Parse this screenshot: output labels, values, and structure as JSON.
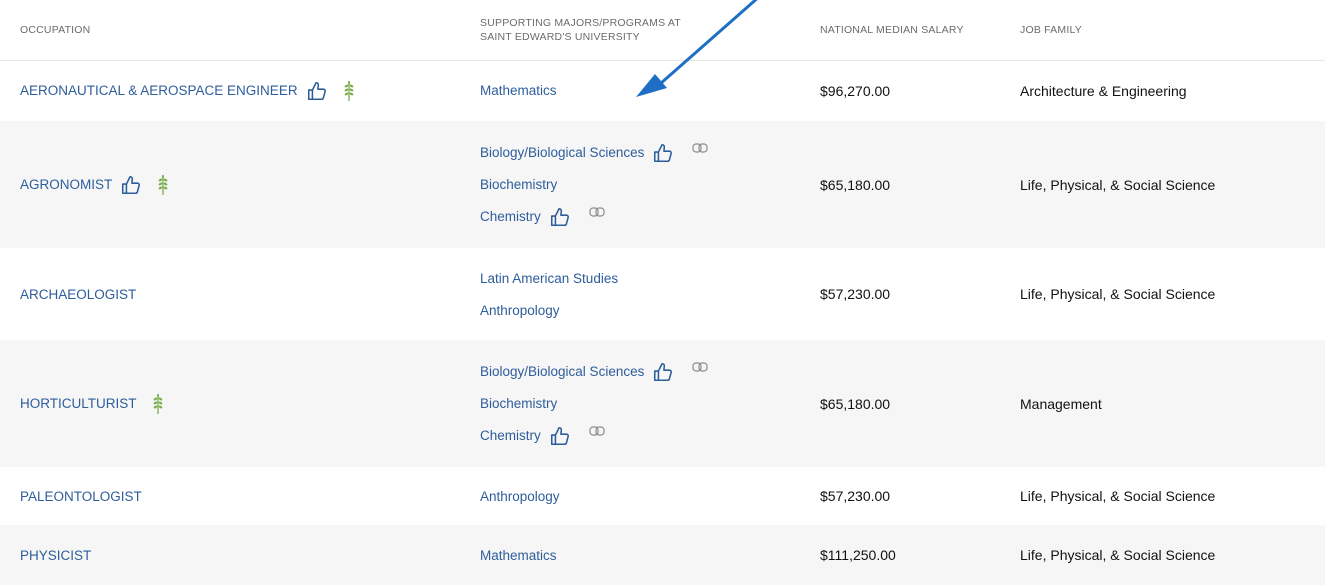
{
  "header": {
    "occupation": "OCCUPATION",
    "majors_line1": "SUPPORTING MAJORS/PROGRAMS AT",
    "majors_line2": "SAINT EDWARD'S UNIVERSITY",
    "salary": "NATIONAL MEDIAN SALARY",
    "family": "JOB FAMILY"
  },
  "colors": {
    "link": "#2e5d9b",
    "row_shade": "#f6f6f6",
    "wheat": "#7cae4e",
    "arrow": "#1e6fc4"
  },
  "rows": [
    {
      "occupation": "AERONAUTICAL & AEROSPACE ENGINEER",
      "icons": [
        "thumbs-up-icon",
        "wheat-icon"
      ],
      "majors": [
        {
          "label": "Mathematics",
          "icons": []
        }
      ],
      "salary": "$96,270.00",
      "family": "Architecture & Engineering"
    },
    {
      "occupation": "AGRONOMIST",
      "icons": [
        "thumbs-up-icon",
        "wheat-icon"
      ],
      "majors": [
        {
          "label": "Biology/Biological Sciences",
          "icons": [
            "thumbs-up-icon",
            "link-icon"
          ]
        },
        {
          "label": "Biochemistry",
          "icons": []
        },
        {
          "label": "Chemistry",
          "icons": [
            "thumbs-up-icon",
            "link-icon"
          ]
        }
      ],
      "salary": "$65,180.00",
      "family": "Life, Physical, & Social Science"
    },
    {
      "occupation": "ARCHAEOLOGIST",
      "icons": [],
      "majors": [
        {
          "label": "Latin American Studies",
          "icons": []
        },
        {
          "label": "Anthropology",
          "icons": []
        }
      ],
      "salary": "$57,230.00",
      "family": "Life, Physical, & Social Science"
    },
    {
      "occupation": "HORTICULTURIST",
      "icons": [
        "wheat-icon"
      ],
      "majors": [
        {
          "label": "Biology/Biological Sciences",
          "icons": [
            "thumbs-up-icon",
            "link-icon"
          ]
        },
        {
          "label": "Biochemistry",
          "icons": []
        },
        {
          "label": "Chemistry",
          "icons": [
            "thumbs-up-icon",
            "link-icon"
          ]
        }
      ],
      "salary": "$65,180.00",
      "family": "Management"
    },
    {
      "occupation": "PALEONTOLOGIST",
      "icons": [],
      "majors": [
        {
          "label": "Anthropology",
          "icons": []
        }
      ],
      "salary": "$57,230.00",
      "family": "Life, Physical, & Social Science"
    },
    {
      "occupation": "PHYSICIST",
      "icons": [],
      "majors": [
        {
          "label": "Mathematics",
          "icons": []
        }
      ],
      "salary": "$111,250.00",
      "family": "Life, Physical, & Social Science"
    }
  ]
}
